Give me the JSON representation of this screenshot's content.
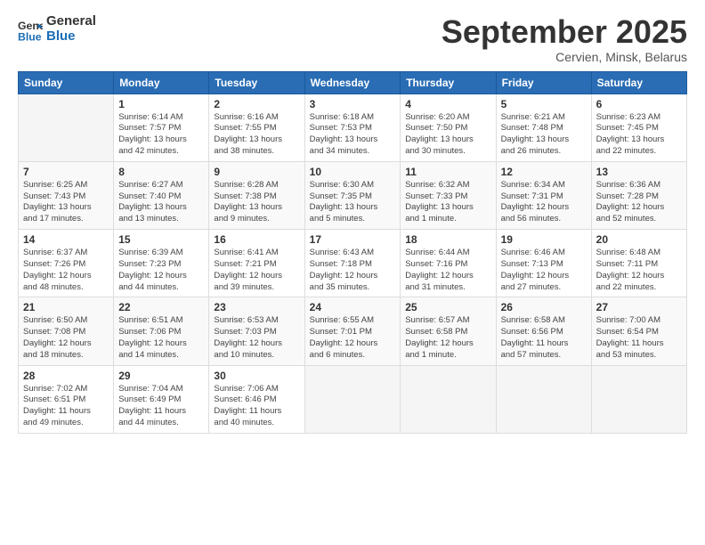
{
  "header": {
    "logo_line1": "General",
    "logo_line2": "Blue",
    "month": "September 2025",
    "location": "Cervien, Minsk, Belarus"
  },
  "weekdays": [
    "Sunday",
    "Monday",
    "Tuesday",
    "Wednesday",
    "Thursday",
    "Friday",
    "Saturday"
  ],
  "weeks": [
    [
      {
        "day": "",
        "info": ""
      },
      {
        "day": "1",
        "info": "Sunrise: 6:14 AM\nSunset: 7:57 PM\nDaylight: 13 hours\nand 42 minutes."
      },
      {
        "day": "2",
        "info": "Sunrise: 6:16 AM\nSunset: 7:55 PM\nDaylight: 13 hours\nand 38 minutes."
      },
      {
        "day": "3",
        "info": "Sunrise: 6:18 AM\nSunset: 7:53 PM\nDaylight: 13 hours\nand 34 minutes."
      },
      {
        "day": "4",
        "info": "Sunrise: 6:20 AM\nSunset: 7:50 PM\nDaylight: 13 hours\nand 30 minutes."
      },
      {
        "day": "5",
        "info": "Sunrise: 6:21 AM\nSunset: 7:48 PM\nDaylight: 13 hours\nand 26 minutes."
      },
      {
        "day": "6",
        "info": "Sunrise: 6:23 AM\nSunset: 7:45 PM\nDaylight: 13 hours\nand 22 minutes."
      }
    ],
    [
      {
        "day": "7",
        "info": "Sunrise: 6:25 AM\nSunset: 7:43 PM\nDaylight: 13 hours\nand 17 minutes."
      },
      {
        "day": "8",
        "info": "Sunrise: 6:27 AM\nSunset: 7:40 PM\nDaylight: 13 hours\nand 13 minutes."
      },
      {
        "day": "9",
        "info": "Sunrise: 6:28 AM\nSunset: 7:38 PM\nDaylight: 13 hours\nand 9 minutes."
      },
      {
        "day": "10",
        "info": "Sunrise: 6:30 AM\nSunset: 7:35 PM\nDaylight: 13 hours\nand 5 minutes."
      },
      {
        "day": "11",
        "info": "Sunrise: 6:32 AM\nSunset: 7:33 PM\nDaylight: 13 hours\nand 1 minute."
      },
      {
        "day": "12",
        "info": "Sunrise: 6:34 AM\nSunset: 7:31 PM\nDaylight: 12 hours\nand 56 minutes."
      },
      {
        "day": "13",
        "info": "Sunrise: 6:36 AM\nSunset: 7:28 PM\nDaylight: 12 hours\nand 52 minutes."
      }
    ],
    [
      {
        "day": "14",
        "info": "Sunrise: 6:37 AM\nSunset: 7:26 PM\nDaylight: 12 hours\nand 48 minutes."
      },
      {
        "day": "15",
        "info": "Sunrise: 6:39 AM\nSunset: 7:23 PM\nDaylight: 12 hours\nand 44 minutes."
      },
      {
        "day": "16",
        "info": "Sunrise: 6:41 AM\nSunset: 7:21 PM\nDaylight: 12 hours\nand 39 minutes."
      },
      {
        "day": "17",
        "info": "Sunrise: 6:43 AM\nSunset: 7:18 PM\nDaylight: 12 hours\nand 35 minutes."
      },
      {
        "day": "18",
        "info": "Sunrise: 6:44 AM\nSunset: 7:16 PM\nDaylight: 12 hours\nand 31 minutes."
      },
      {
        "day": "19",
        "info": "Sunrise: 6:46 AM\nSunset: 7:13 PM\nDaylight: 12 hours\nand 27 minutes."
      },
      {
        "day": "20",
        "info": "Sunrise: 6:48 AM\nSunset: 7:11 PM\nDaylight: 12 hours\nand 22 minutes."
      }
    ],
    [
      {
        "day": "21",
        "info": "Sunrise: 6:50 AM\nSunset: 7:08 PM\nDaylight: 12 hours\nand 18 minutes."
      },
      {
        "day": "22",
        "info": "Sunrise: 6:51 AM\nSunset: 7:06 PM\nDaylight: 12 hours\nand 14 minutes."
      },
      {
        "day": "23",
        "info": "Sunrise: 6:53 AM\nSunset: 7:03 PM\nDaylight: 12 hours\nand 10 minutes."
      },
      {
        "day": "24",
        "info": "Sunrise: 6:55 AM\nSunset: 7:01 PM\nDaylight: 12 hours\nand 6 minutes."
      },
      {
        "day": "25",
        "info": "Sunrise: 6:57 AM\nSunset: 6:58 PM\nDaylight: 12 hours\nand 1 minute."
      },
      {
        "day": "26",
        "info": "Sunrise: 6:58 AM\nSunset: 6:56 PM\nDaylight: 11 hours\nand 57 minutes."
      },
      {
        "day": "27",
        "info": "Sunrise: 7:00 AM\nSunset: 6:54 PM\nDaylight: 11 hours\nand 53 minutes."
      }
    ],
    [
      {
        "day": "28",
        "info": "Sunrise: 7:02 AM\nSunset: 6:51 PM\nDaylight: 11 hours\nand 49 minutes."
      },
      {
        "day": "29",
        "info": "Sunrise: 7:04 AM\nSunset: 6:49 PM\nDaylight: 11 hours\nand 44 minutes."
      },
      {
        "day": "30",
        "info": "Sunrise: 7:06 AM\nSunset: 6:46 PM\nDaylight: 11 hours\nand 40 minutes."
      },
      {
        "day": "",
        "info": ""
      },
      {
        "day": "",
        "info": ""
      },
      {
        "day": "",
        "info": ""
      },
      {
        "day": "",
        "info": ""
      }
    ]
  ]
}
